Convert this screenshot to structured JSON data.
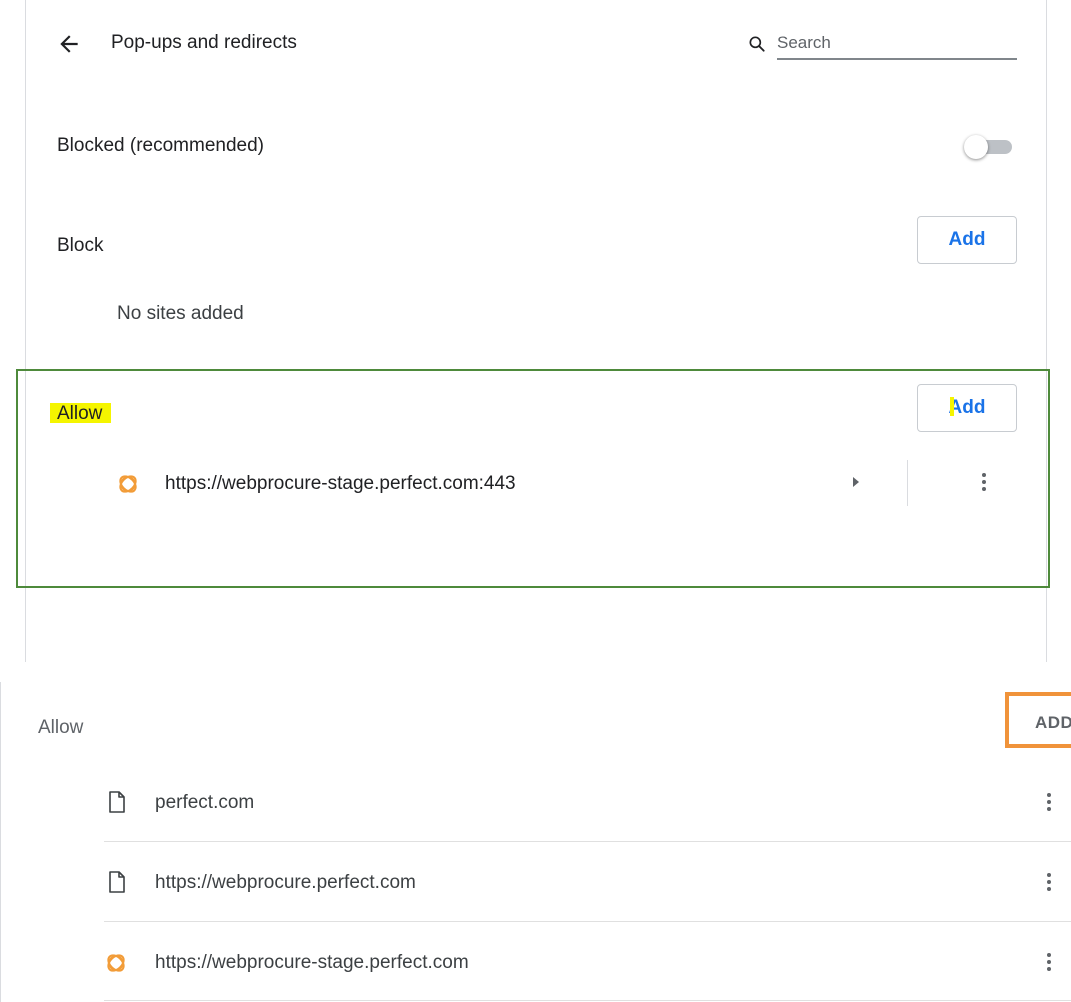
{
  "header": {
    "title": "Pop-ups and redirects",
    "search_placeholder": "Search"
  },
  "default_setting": {
    "label": "Blocked (recommended)",
    "enabled": false
  },
  "block_section": {
    "heading": "Block",
    "add_label": "Add",
    "empty_text": "No sites added"
  },
  "allow_section": {
    "heading": "Allow",
    "add_label": "Add",
    "sites": [
      {
        "url": "https://webprocure-stage.perfect.com:443",
        "icon": "site-favicon-icon"
      }
    ]
  },
  "bottom_allow": {
    "heading": "Allow",
    "add_label": "ADD",
    "sites": [
      {
        "url": "perfect.com",
        "icon": "document-icon"
      },
      {
        "url": "https://webprocure.perfect.com",
        "icon": "document-icon"
      },
      {
        "url": "https://webprocure-stage.perfect.com",
        "icon": "site-favicon-icon"
      }
    ]
  },
  "colors": {
    "accent": "#1a73e8",
    "highlight": "#f5f500",
    "green_annotation": "#4e8a3b",
    "orange_annotation": "#f0933a",
    "favicon": "#f29c38"
  }
}
